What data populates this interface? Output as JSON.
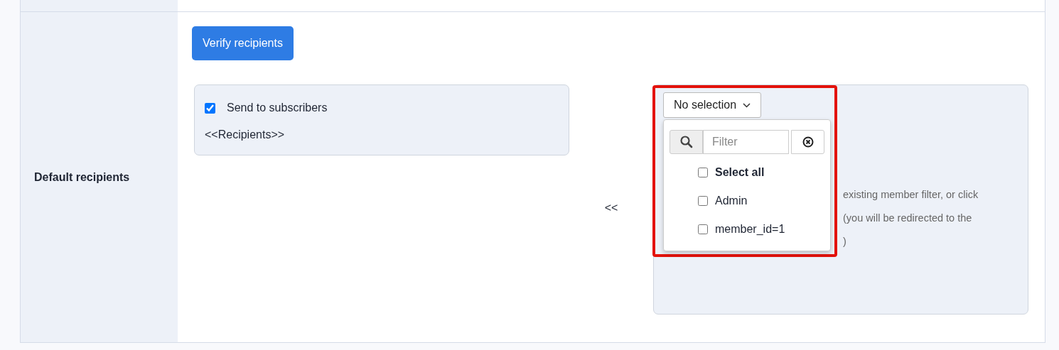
{
  "row_label": "Default recipients",
  "verify_button": "Verify recipients",
  "subscribers": {
    "label": "Send to subscribers",
    "checked": true
  },
  "recipients_token": "<<Recipients>>",
  "move_left": "<<",
  "selector": {
    "label": "No selection",
    "expanded": true,
    "filter": {
      "placeholder": "Filter"
    },
    "options": [
      {
        "label": "Select all",
        "kind": "all",
        "checked": false
      },
      {
        "label": "Admin",
        "kind": "item",
        "checked": false
      },
      {
        "label": "member_id=1",
        "kind": "item",
        "checked": false
      }
    ]
  },
  "help_lines": [
    "existing member filter, or click",
    "(you will be redirected to the",
    ")"
  ]
}
